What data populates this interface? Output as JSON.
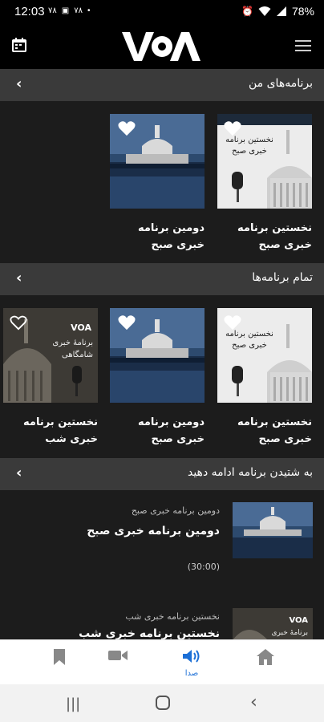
{
  "status_bar": {
    "time": "12:03",
    "left_labels": [
      "۷۸",
      "۷۸"
    ],
    "battery": "78%"
  },
  "header": {
    "logo_text": "VOA",
    "calendar_icon": "calendar-icon",
    "menu_icon": "hamburger-menu-icon"
  },
  "sections": [
    {
      "title": "برنامه‌های من",
      "tiles": [
        {
          "label": "نخستین برنامه خبری صبح",
          "art_text": "نخستین برنامه خبری صبح",
          "kind": "capitol-art"
        },
        {
          "label": "دومین برنامه خبری صبح",
          "kind": "capitol-photo"
        }
      ]
    },
    {
      "title": "تمام برنامه‌ها",
      "tiles": [
        {
          "label": "نخستین برنامه خبری صبح",
          "art_text": "نخستین برنامه خبری صبح",
          "kind": "capitol-art"
        },
        {
          "label": "دومین برنامه خبری صبح",
          "kind": "capitol-photo"
        },
        {
          "label": "نخستین برنامه خبری شب",
          "art_text": "برنامهٔ خبری شامگاهی",
          "kind": "capitol-dark"
        }
      ]
    },
    {
      "title": "به شتیدن برنامه ادامه دهید"
    }
  ],
  "continue_list": [
    {
      "subtitle": "دومین برنامه خبری صبح",
      "title": "دومین برنامه خبری صبح",
      "duration": "(30:00)"
    },
    {
      "subtitle": "نخستین برنامه خبری شب",
      "title": "نخستین برنامه خبری شب",
      "thumb_logo": "VOA",
      "thumb_text": "برنامهٔ خبری"
    }
  ],
  "bottom_nav": {
    "items": [
      {
        "icon": "bookmark-icon"
      },
      {
        "icon": "video-camera-icon"
      },
      {
        "icon": "speaker-icon",
        "label": "صدا",
        "active": true
      },
      {
        "icon": "home-icon"
      }
    ]
  },
  "colors": {
    "background": "#1c1c1c",
    "section_header": "#3a3a3a",
    "accent": "#1c6fd6"
  }
}
